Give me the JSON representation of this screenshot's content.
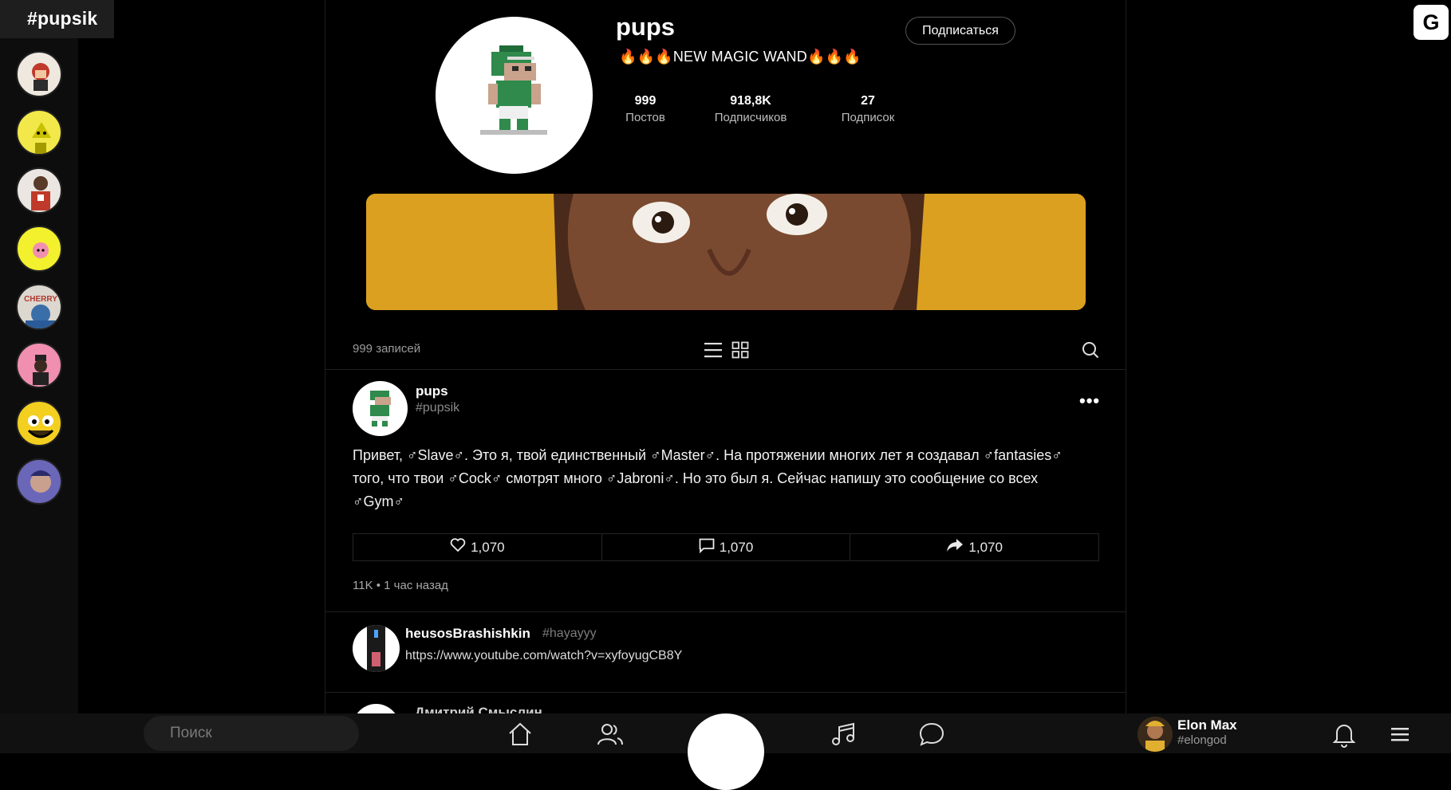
{
  "sidebar": {
    "tag": "#pupsik",
    "stories": [
      {
        "name": "story-1",
        "color": "#e9e1d8"
      },
      {
        "name": "story-2",
        "color": "#f2e84a"
      },
      {
        "name": "story-3",
        "color": "#ebe6e2"
      },
      {
        "name": "story-4",
        "color": "#f3f02d"
      },
      {
        "name": "story-5",
        "color": "#dcd7cf"
      },
      {
        "name": "story-6",
        "color": "#f08fb0"
      },
      {
        "name": "story-7",
        "color": "#f3cf20"
      },
      {
        "name": "story-8",
        "color": "#6a66b8"
      }
    ]
  },
  "corner_button": {
    "label": "G"
  },
  "profile": {
    "name": "pups",
    "bio": "🔥🔥🔥NEW MAGIC WAND🔥🔥🔥",
    "follow_label": "Подписаться",
    "stats": [
      {
        "value": "999",
        "label": "Постов"
      },
      {
        "value": "918,8K",
        "label": "Подписчиков"
      },
      {
        "value": "27",
        "label": "Подписок"
      }
    ],
    "banner_color": "#dba020"
  },
  "feed_toolbar": {
    "count_label": "999 записей",
    "icons": [
      "list-view-icon",
      "grid-view-icon",
      "search-icon"
    ]
  },
  "post": {
    "author": "pups",
    "handle": "#pupsik",
    "text": "Привет, ♂Slave♂. Это я, твой единственный ♂Master♂. На протяжении многих лет я создавал ♂fantasies♂ того, что твои ♂Cock♂ смотрят много ♂Jabroni♂. Но это был я. Сейчас напишу это сообщение со всех ♂Gym♂",
    "more_label": "•••",
    "likes": "1,070",
    "comments": "1,070",
    "shares": "1,070",
    "meta": "11K • 1 час назад"
  },
  "comment": {
    "author": "heusosBrashishkin",
    "tag": "#hayayyy",
    "text": "https://www.youtube.com/watch?v=xyfoyugCB8Y"
  },
  "next_comment": {
    "author": "Дмитрий Смыслин"
  },
  "bottom_bar": {
    "search_placeholder": "Поиск",
    "user_name": "Elon Max",
    "user_handle": "#elongod"
  }
}
